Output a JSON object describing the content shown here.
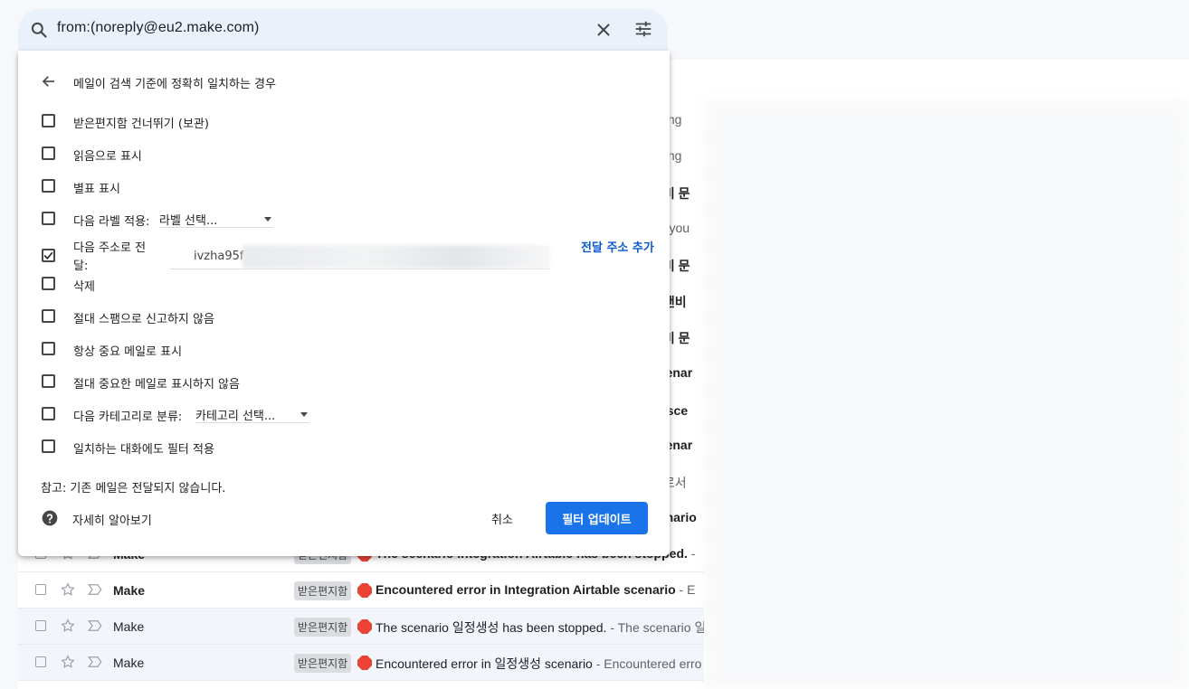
{
  "search": {
    "query": "from:(noreply@eu2.make.com)"
  },
  "filter_panel": {
    "heading": "메일이 검색 기준에 정확히 일치하는 경우",
    "options": [
      {
        "label": "받은편지함 건너뛰기 (보관)",
        "checked": false
      },
      {
        "label": "읽음으로 표시",
        "checked": false
      },
      {
        "label": "별표 표시",
        "checked": false
      },
      {
        "label": "다음 라벨 적용:",
        "checked": false,
        "select": "라벨 선택..."
      },
      {
        "label": "다음 주소로 전달:",
        "checked": true,
        "select": "ivzha95f"
      },
      {
        "label": "삭제",
        "checked": false
      },
      {
        "label": "절대 스팸으로 신고하지 않음",
        "checked": false
      },
      {
        "label": "항상 중요 메일로 표시",
        "checked": false
      },
      {
        "label": "절대 중요한 메일로 표시하지 않음",
        "checked": false
      },
      {
        "label": "다음 카테고리로 분류:",
        "checked": false,
        "select": "카테고리 선택..."
      },
      {
        "label": "일치하는 대화에도 필터 적용",
        "checked": false
      }
    ],
    "add_forward_address": "전달 주소 추가",
    "note": "참고: 기존 메일은 전달되지 않습니다.",
    "learn_more": "자세히 알아보기",
    "cancel": "취소",
    "update": "필터 업데이트"
  },
  "inbox_peek": [
    "ching",
    "ching",
    "앤비 문",
    "ng you",
    "앤비 문",
    "비앤비",
    "앤비 문",
    "scenar",
    "편 sce",
    "scenar",
    "브로서",
    "cenario"
  ],
  "mail_rows": [
    {
      "sender": "Make",
      "label": "받은편지함",
      "subject": "The scenario Integration Airtable has been stopped.",
      "snippet": " - ",
      "unread": true
    },
    {
      "sender": "Make",
      "label": "받은편지함",
      "subject": "Encountered error in Integration Airtable scenario",
      "snippet": " - E",
      "unread": true
    },
    {
      "sender": "Make",
      "label": "받은편지함",
      "subject": "The scenario 일정생성 has been stopped.",
      "snippet": " - The scenario 일",
      "unread": false
    },
    {
      "sender": "Make",
      "label": "받은편지함",
      "subject": "Encountered error in 일정생성 scenario",
      "snippet": " - Encountered erro",
      "unread": false
    }
  ],
  "colors": {
    "accent": "#1a73e8",
    "link": "#0b57d0",
    "search_bg": "#eaf1fb",
    "stop_red": "#ea4335"
  },
  "icons": [
    "search-icon",
    "close-icon",
    "tune-icon",
    "arrow-back-icon",
    "check-icon",
    "help-icon",
    "star-icon",
    "important-icon",
    "stop-sign-icon"
  ]
}
